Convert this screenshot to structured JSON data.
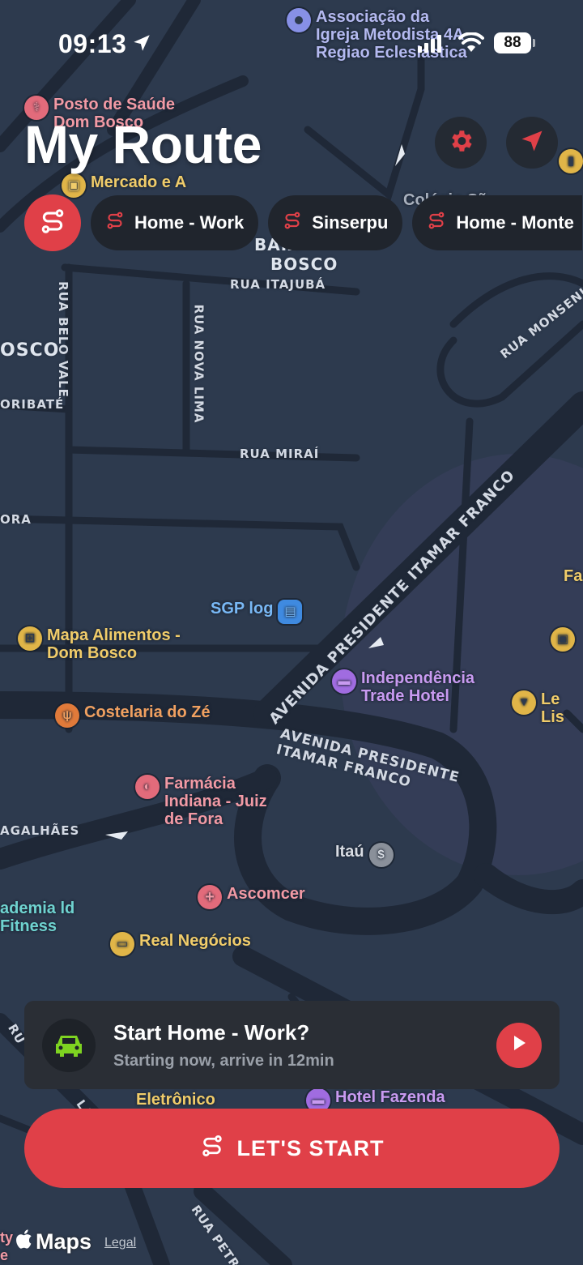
{
  "status_bar": {
    "time": "09:13",
    "battery": "88"
  },
  "header": {
    "title": "My Route"
  },
  "routes": {
    "chips": [
      {
        "label": "Home - Work"
      },
      {
        "label": "Sinserpu"
      },
      {
        "label": "Home - Monte"
      }
    ]
  },
  "map": {
    "neighborhoods": {
      "baixo": "BAIX",
      "bosco": "BOSCO",
      "bosco_left": "OSCO"
    },
    "streets": {
      "itajuba": "RUA ITAJUBÁ",
      "belo_vale": "RUA BELO VALE",
      "nova_lima": "RUA NOVA LIMA",
      "mirai": "RUA MIRAÍ",
      "oribate": "ORIBATÉ",
      "ora": "ORA",
      "monsenhor": "RUA MONSENH",
      "itamar_diag": "AVENIDA PRESIDENTE ITAMAR FRANCO",
      "itamar_curve": "AVENIDA PRESIDENTE ITAMAR FRANCO",
      "agalhaes": "AGALHÃES",
      "petrus": "RUA PETRUS",
      "laka": "LAKA",
      "ru": "RU"
    },
    "pois": {
      "associacao": "Associação da Igreja Metodista 4A Regiao Eclesiastica",
      "posto": "Posto de Saúde Dom Bosco",
      "mercado": "Mercado e A",
      "colegio": "Colégio Sã",
      "sgp": "SGP log",
      "mapa": "Mapa Alimentos - Dom Bosco",
      "independencia": "Independência Trade Hotel",
      "le_lis": "Le Lis",
      "fa": "Fa",
      "costelaria": "Costelaria do Zé",
      "farmacia": "Farmácia Indiana - Juiz de Fora",
      "itau": "Itaú",
      "ascomcer": "Ascomcer",
      "academia": "ademia ld Fitness",
      "real": "Real Negócios",
      "eletronico": "Eletrônico",
      "hotel_fazenda": "Hotel Fazenda",
      "ty": "ty e"
    }
  },
  "suggestion": {
    "title": "Start Home - Work?",
    "subtitle": "Starting now, arrive in 12min"
  },
  "cta": {
    "label": "LET'S START"
  },
  "footer": {
    "maps": "Maps",
    "legal": "Legal"
  },
  "colors": {
    "accent": "#e04048",
    "map_bg": "#2d3a4e",
    "card": "#2a2e35",
    "chip": "#20252d"
  }
}
